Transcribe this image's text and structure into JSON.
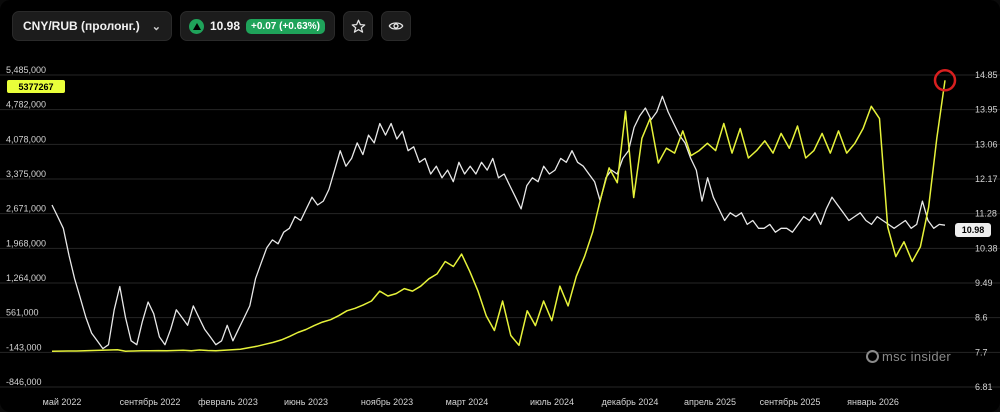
{
  "toolbar": {
    "ticker": "CNY/RUB (пролонг.)",
    "price": "10.98",
    "change": "+0.07 (+0.63%)"
  },
  "watermark": "msc insider",
  "colors": {
    "volume": "#e6f23a",
    "price": "#e8e8e8",
    "marker": "#d81f1f",
    "bg": "#000000",
    "grid": "#2a2a2a"
  },
  "icons": {
    "dropdown": "chevron-down-icon",
    "up": "triangle-up-icon",
    "star": "star-icon",
    "eye": "eye-icon"
  },
  "chart_data": {
    "type": "line",
    "x_ticks": [
      "май 2022",
      "сентябрь 2022",
      "февраль 2023",
      "июнь 2023",
      "ноябрь 2023",
      "март 2024",
      "июль 2024",
      "декабрь 2024",
      "апрель 2025",
      "сентябрь 2025",
      "январь 2026"
    ],
    "left_axis": {
      "ticks": [
        "5,485,000",
        "4,782,000",
        "4,078,000",
        "3,375,000",
        "2,671,000",
        "1,968,000",
        "1,264,000",
        "561,000",
        "-143,000",
        "-846,000"
      ],
      "ylim": [
        -846000,
        5485000
      ]
    },
    "right_axis": {
      "ticks": [
        "14.85",
        "13.95",
        "13.06",
        "12.17",
        "11.28",
        "10.38",
        "9.49",
        "8.6",
        "7.7",
        "6.81"
      ],
      "ylim": [
        6.81,
        14.85
      ]
    },
    "left_last_label": "5377267",
    "right_last_label": "10.98",
    "series": [
      {
        "axis": "right",
        "values": [
          11.5,
          11.2,
          10.9,
          10.2,
          9.6,
          9.1,
          8.6,
          8.2,
          8.0,
          7.8,
          7.9,
          8.8,
          9.4,
          8.6,
          8.0,
          7.9,
          8.5,
          9.0,
          8.7,
          8.1,
          7.9,
          8.3,
          8.8,
          8.6,
          8.4,
          8.9,
          8.6,
          8.3,
          8.1,
          7.9,
          8.0,
          8.4,
          8.0,
          8.3,
          8.6,
          8.9,
          9.6,
          10.0,
          10.4,
          10.6,
          10.5,
          10.8,
          10.9,
          11.2,
          11.1,
          11.4,
          11.7,
          11.5,
          11.6,
          11.9,
          12.4,
          12.9,
          12.5,
          12.7,
          13.1,
          12.8,
          13.3,
          13.1,
          13.6,
          13.3,
          13.6,
          13.2,
          13.4,
          12.9,
          13.0,
          12.6,
          12.7,
          12.3,
          12.5,
          12.2,
          12.4,
          12.1,
          12.6,
          12.3,
          12.5,
          12.3,
          12.6,
          12.4,
          12.7,
          12.2,
          12.3,
          12.0,
          11.7,
          11.4,
          12.0,
          12.2,
          12.1,
          12.5,
          12.3,
          12.4,
          12.7,
          12.6,
          12.9,
          12.6,
          12.5,
          12.3,
          12.1,
          11.6,
          12.2,
          12.4,
          12.3,
          12.7,
          12.9,
          13.5,
          13.8,
          14.0,
          13.7,
          13.9,
          14.3,
          13.9,
          13.6,
          13.3,
          13.1,
          12.7,
          12.4,
          11.6,
          12.2,
          11.7,
          11.4,
          11.1,
          11.3,
          11.2,
          11.3,
          11.0,
          11.1,
          10.9,
          10.9,
          11.0,
          10.8,
          10.9,
          10.9,
          10.8,
          11.0,
          11.2,
          11.1,
          11.3,
          11.0,
          11.4,
          11.7,
          11.5,
          11.3,
          11.1,
          11.2,
          11.3,
          11.1,
          11.0,
          11.2,
          11.1,
          11.0,
          10.9,
          11.0,
          11.1,
          10.9,
          11.0,
          11.6,
          11.1,
          10.9,
          11.0,
          10.98
        ]
      },
      {
        "axis": "left",
        "values": [
          -120000,
          -118000,
          -115000,
          -115000,
          -110000,
          -105000,
          -100000,
          -95000,
          -90000,
          -120000,
          -115000,
          -110000,
          -112000,
          -108000,
          -110000,
          -105000,
          -100000,
          -110000,
          -95000,
          -105000,
          -110000,
          -100000,
          -90000,
          -80000,
          -50000,
          -20000,
          20000,
          60000,
          110000,
          180000,
          260000,
          320000,
          400000,
          470000,
          520000,
          600000,
          700000,
          750000,
          820000,
          900000,
          1100000,
          1000000,
          1050000,
          1150000,
          1100000,
          1200000,
          1350000,
          1450000,
          1700000,
          1600000,
          1850000,
          1500000,
          1100000,
          600000,
          300000,
          900000,
          200000,
          0,
          700000,
          400000,
          900000,
          500000,
          1200000,
          800000,
          1400000,
          1800000,
          2300000,
          3000000,
          3600000,
          3300000,
          4750000,
          3000000,
          4200000,
          4600000,
          3700000,
          4000000,
          3900000,
          4350000,
          3850000,
          3950000,
          4100000,
          3950000,
          4500000,
          3900000,
          4400000,
          3800000,
          3950000,
          4150000,
          3900000,
          4300000,
          4000000,
          4450000,
          3800000,
          3950000,
          4300000,
          3900000,
          4350000,
          3900000,
          4100000,
          4400000,
          4850000,
          4600000,
          2400000,
          1800000,
          2100000,
          1700000,
          2000000,
          2800000,
          4200000,
          5377267
        ]
      }
    ]
  }
}
